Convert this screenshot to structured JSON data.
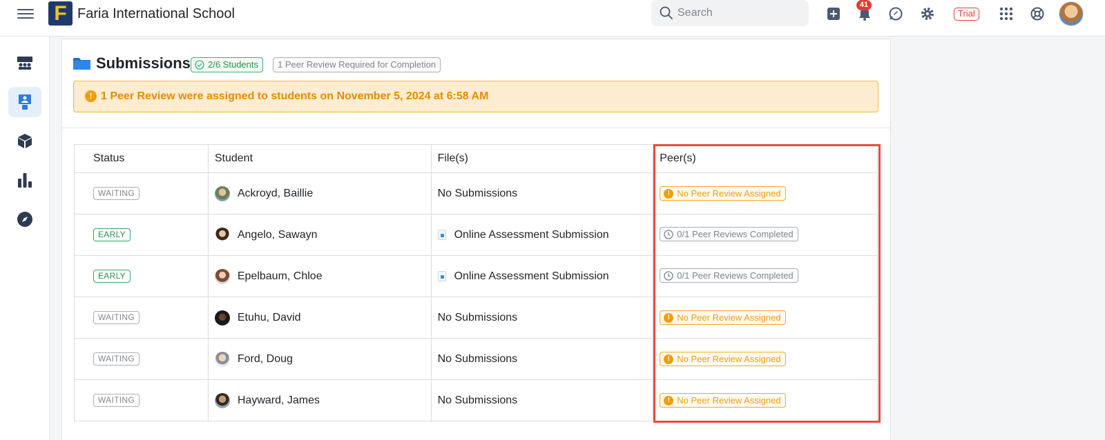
{
  "header": {
    "school_name": "Faria International School",
    "logo_letter": "F",
    "search_placeholder": "Search",
    "notification_count": "41",
    "trial_label": "Trial"
  },
  "sidebar": {
    "items": [
      {
        "icon": "classes-icon"
      },
      {
        "icon": "teacher-icon",
        "active": true
      },
      {
        "icon": "cube-icon"
      },
      {
        "icon": "bar-chart-icon"
      },
      {
        "icon": "compass-icon"
      }
    ]
  },
  "main": {
    "title": "Submissions",
    "students_pill": "2/6 Students",
    "requirement_pill": "1 Peer Review Required for Completion",
    "alert_text": "1 Peer Review were assigned to students on November 5, 2024 at 6:58 AM"
  },
  "table": {
    "headers": [
      "Status",
      "Student",
      "File(s)",
      "Peer(s)"
    ],
    "rows": [
      {
        "status": "WAITING",
        "student": "Ackroyd, Baillie",
        "file": "No Submissions",
        "peer": "No Peer Review Assigned"
      },
      {
        "status": "EARLY",
        "student": "Angelo, Sawayn",
        "file": "Online Assessment Submission",
        "peer": "0/1 Peer Reviews Completed"
      },
      {
        "status": "EARLY",
        "student": "Epelbaum, Chloe",
        "file": "Online Assessment Submission",
        "peer": "0/1 Peer Reviews Completed"
      },
      {
        "status": "WAITING",
        "student": "Etuhu, David",
        "file": "No Submissions",
        "peer": "No Peer Review Assigned"
      },
      {
        "status": "WAITING",
        "student": "Ford, Doug",
        "file": "No Submissions",
        "peer": "No Peer Review Assigned"
      },
      {
        "status": "WAITING",
        "student": "Hayward, James",
        "file": "No Submissions",
        "peer": "No Peer Review Assigned"
      }
    ]
  },
  "colors": {
    "highlight": "#e74c3c",
    "warning": "#f29d0b",
    "success": "#23904f",
    "brand": "#1e3a6b"
  }
}
